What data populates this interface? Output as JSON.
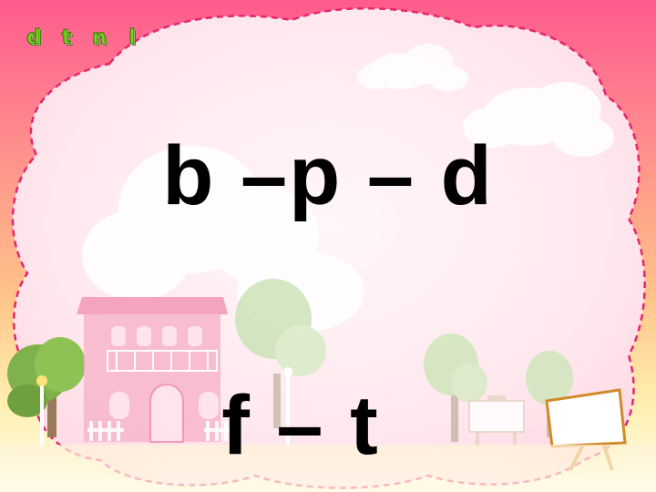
{
  "header": {
    "letters": [
      "d",
      "t",
      "n",
      "l"
    ]
  },
  "content": {
    "line1": "b –p – d",
    "line2": "f – t"
  },
  "colors": {
    "background_top": "#ff5b8c",
    "background_bottom": "#fffbe8",
    "frame_dash": "#e8246e",
    "letter_green": "#7ed321",
    "text": "#000000"
  }
}
